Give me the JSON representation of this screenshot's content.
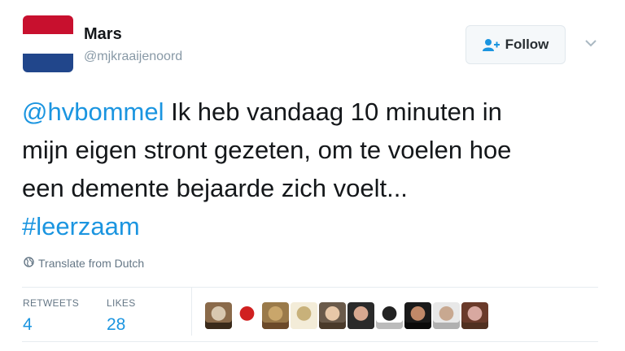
{
  "author": {
    "display_name": "Mars",
    "handle": "@mjkraaijenoord",
    "avatar_colors": [
      "#c8102e",
      "#ffffff",
      "#21468b"
    ]
  },
  "follow_button": {
    "label": "Follow",
    "icon": "add-user-icon"
  },
  "tweet": {
    "mention": "@hvbommel",
    "text_line1_rest": " Ik heb vandaag 10 minuten in",
    "text_line2": "mijn eigen stront gezeten, om te voelen hoe",
    "text_line3": "een demente bejaarde zich voelt...",
    "hashtag": "#leerzaam"
  },
  "translate": {
    "label": "Translate from Dutch",
    "icon": "globe-icon"
  },
  "stats": {
    "retweets_label": "RETWEETS",
    "retweets_value": "4",
    "likes_label": "LIKES",
    "likes_value": "28"
  },
  "likers": [
    {
      "colors": [
        "#8a6a4a",
        "#d8c8b0",
        "#3a2a1a"
      ]
    },
    {
      "colors": [
        "#ffffff",
        "#d02020",
        "#ffffff"
      ]
    },
    {
      "colors": [
        "#9a7a4a",
        "#c9a66b",
        "#6b4a2a"
      ]
    },
    {
      "colors": [
        "#f3ecd8",
        "#c8b17a",
        "#f3ecd8"
      ]
    },
    {
      "colors": [
        "#6a5a4a",
        "#e8c8a8",
        "#4a3a2a"
      ]
    },
    {
      "colors": [
        "#2a2a2a",
        "#d8a890",
        "#2a2a2a"
      ]
    },
    {
      "colors": [
        "#ffffff",
        "#222222",
        "#bbbbbb"
      ]
    },
    {
      "colors": [
        "#1a1a1a",
        "#c08868",
        "#0a0a0a"
      ]
    },
    {
      "colors": [
        "#e8e8e8",
        "#c8a890",
        "#b0b0b0"
      ]
    },
    {
      "colors": [
        "#6a3a2a",
        "#d8a8a0",
        "#503020"
      ]
    }
  ]
}
